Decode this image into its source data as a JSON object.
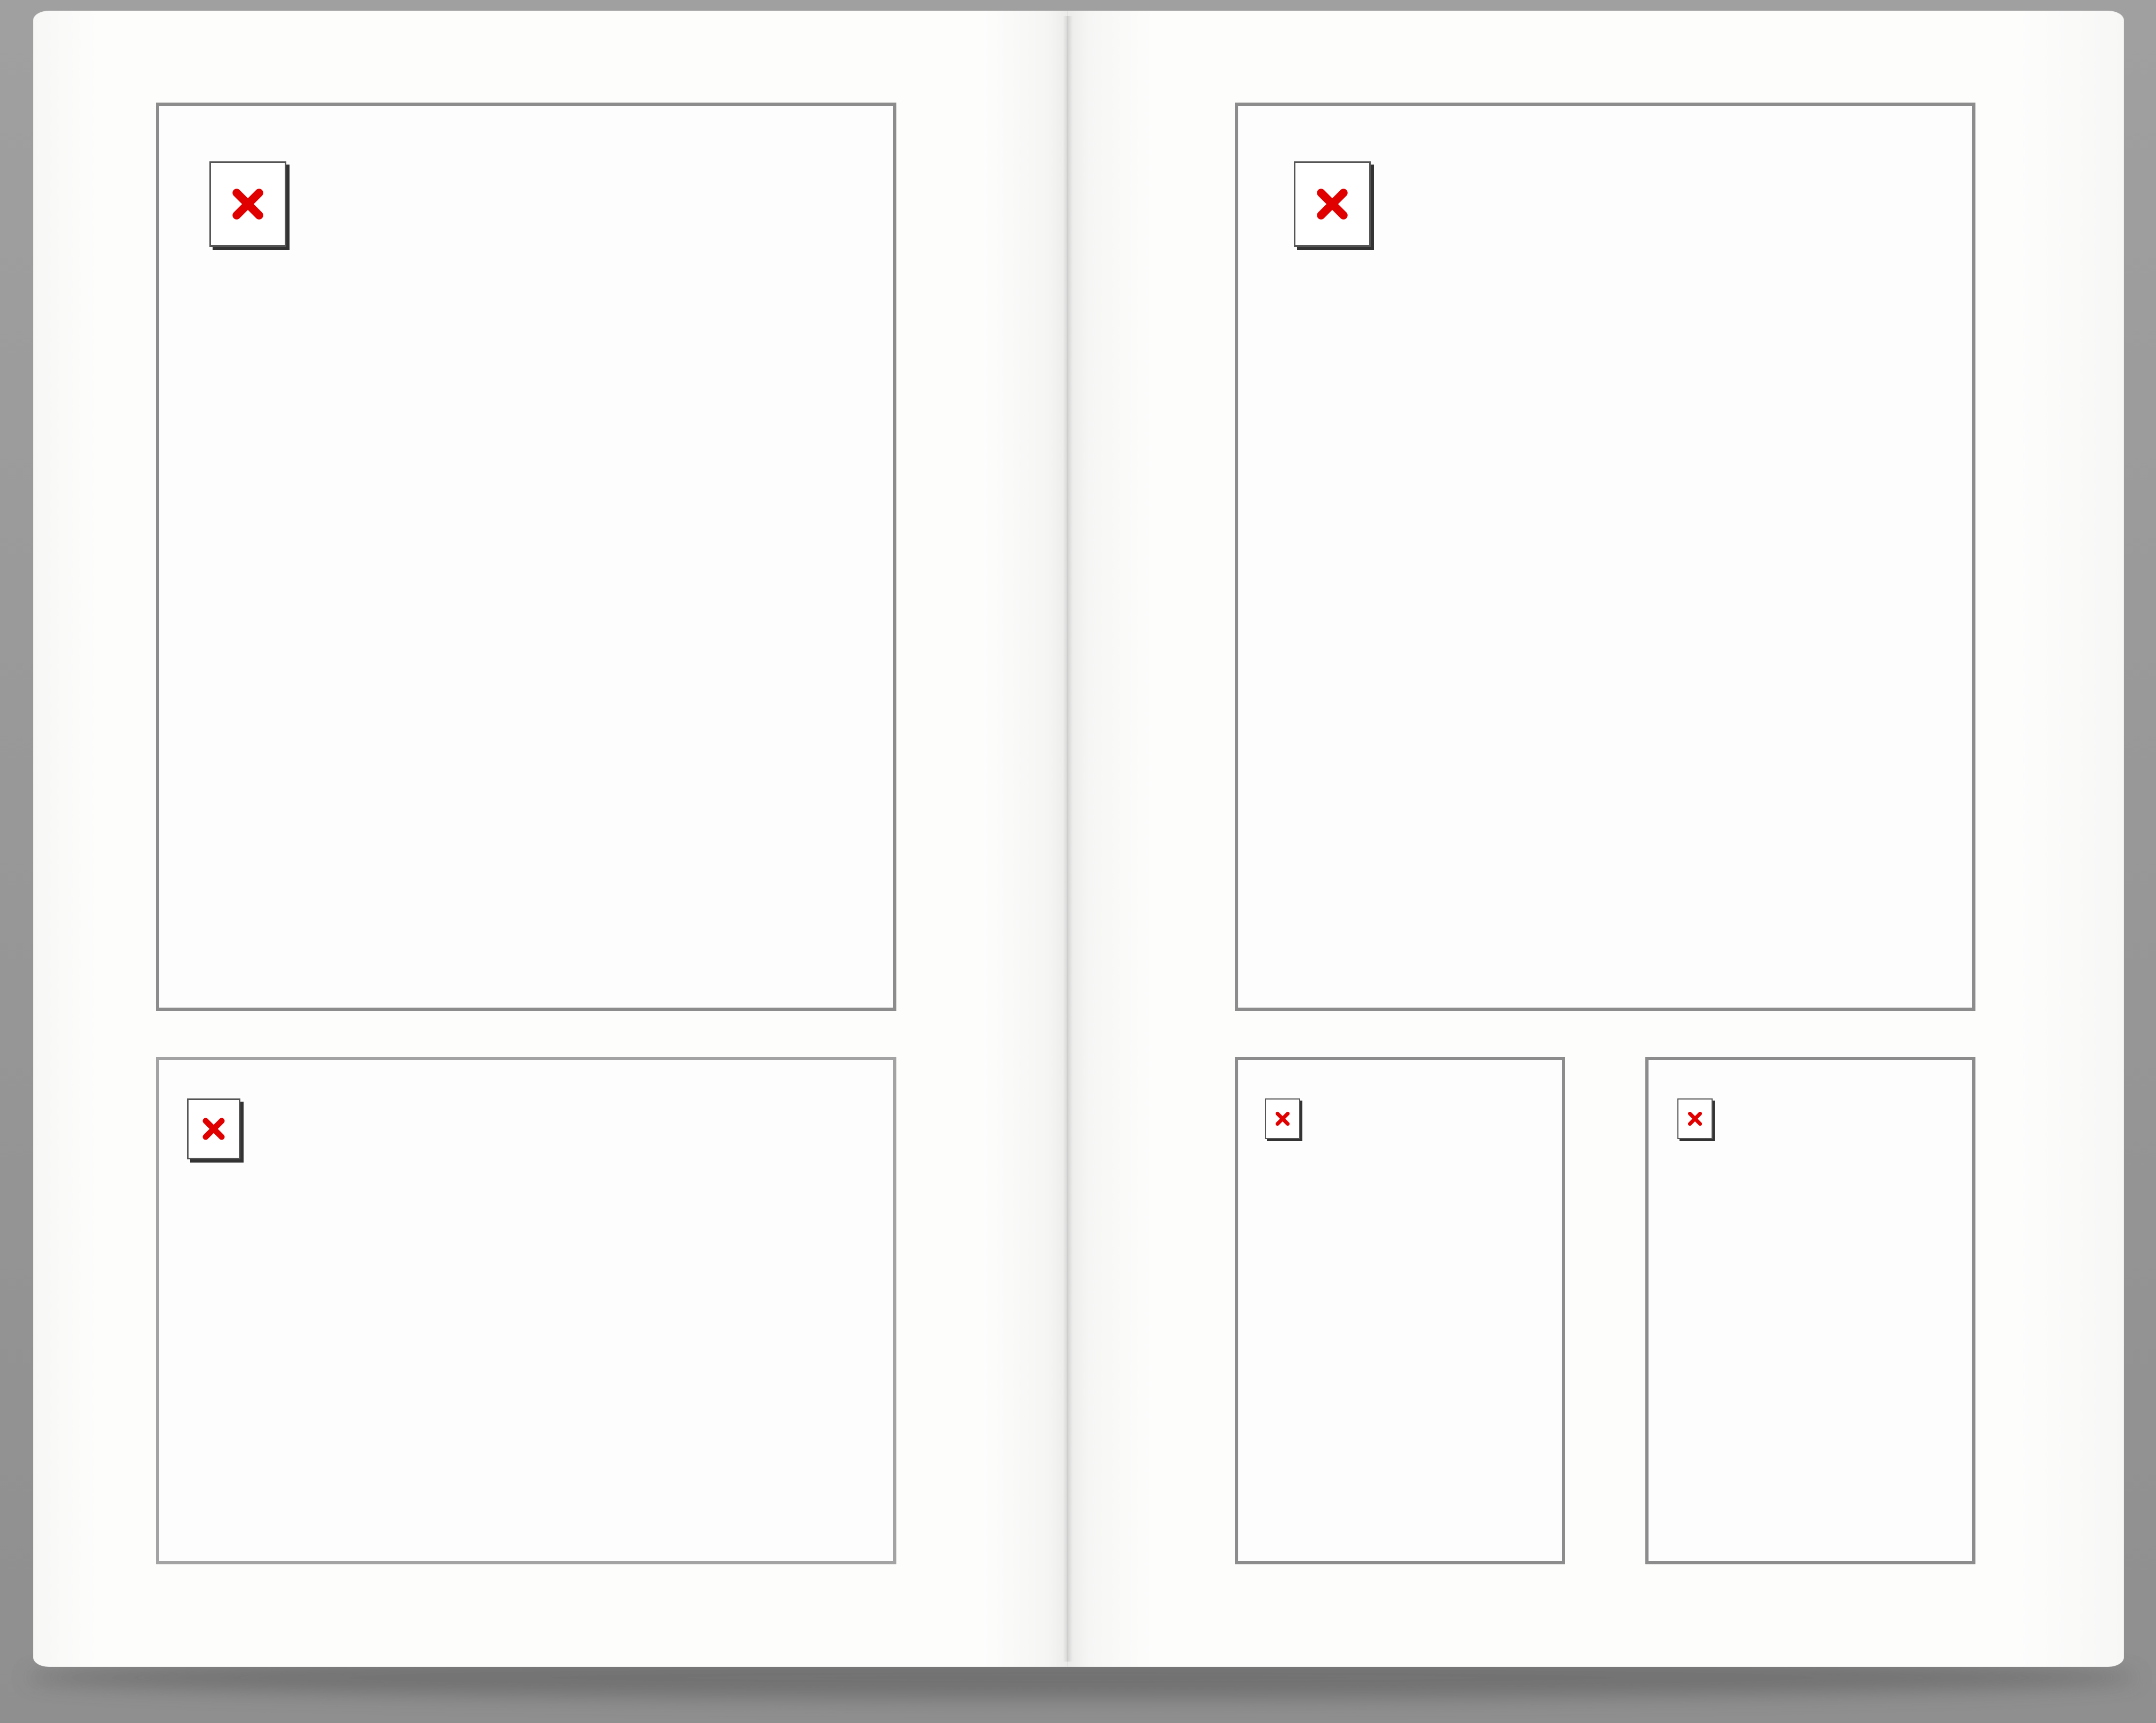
{
  "scene": {
    "description_free": true,
    "background_color": "#9a9a9a"
  },
  "spread": {
    "left_page": {
      "frames": [
        {
          "id": "frame-left-top",
          "placeholder_icon": "broken-image-icon"
        },
        {
          "id": "frame-left-bottom",
          "placeholder_icon": "broken-image-icon"
        }
      ]
    },
    "right_page": {
      "frames": [
        {
          "id": "frame-right-top",
          "placeholder_icon": "broken-image-icon"
        },
        {
          "id": "frame-right-bottom-left",
          "placeholder_icon": "broken-image-icon"
        },
        {
          "id": "frame-right-bottom-right",
          "placeholder_icon": "broken-image-icon"
        }
      ]
    }
  },
  "colors": {
    "page": "#fdfdfc",
    "frame_border": "#8c8c8c",
    "x_mark": "#e00000"
  }
}
